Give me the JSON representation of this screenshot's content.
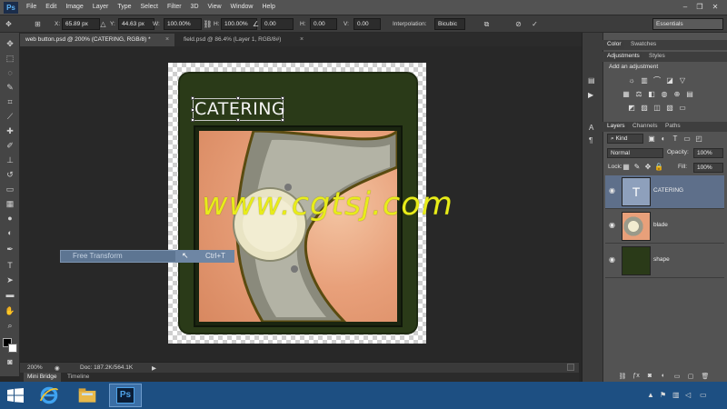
{
  "app": {
    "logo": "Ps"
  },
  "menu": [
    "File",
    "Edit",
    "Image",
    "Layer",
    "Type",
    "Select",
    "Filter",
    "3D",
    "View",
    "Window",
    "Help"
  ],
  "window_controls": {
    "minimize": "–",
    "restore": "❐",
    "close": "✕"
  },
  "options_bar": {
    "x_label": "X:",
    "x_value": "65.89 px",
    "y_label": "Y:",
    "y_value": "44.63 px",
    "w_label": "W:",
    "w_value": "100.00%",
    "h_label": "H:",
    "h_value": "100.00%",
    "angle_value": "0.00",
    "hskew_label": "H:",
    "hskew_value": "0.00",
    "vskew_label": "V:",
    "vskew_value": "0.00",
    "interp_label": "Interpolation:",
    "interp_value": "Bicubic",
    "workspace": "Essentials"
  },
  "doc_tabs": [
    {
      "label": "web button.psd @ 200% (CATERING, RGB/8) *",
      "close": "×"
    },
    {
      "label": "field.psd @ 86.4% (Layer 1, RGB/8#)",
      "close": "×"
    }
  ],
  "canvas": {
    "heading": "CATERING"
  },
  "watermark": "www.cgtsj.com",
  "tooltip": {
    "label": "Free Transform",
    "shortcut": "Ctrl+T"
  },
  "status": {
    "zoom": "200%",
    "doc": "Doc: 187.2K/564.1K",
    "arrow": "▶"
  },
  "bottom_tabs": [
    "Mini Bridge",
    "Timeline"
  ],
  "panels": {
    "color_tabs": [
      "Color",
      "Swatches"
    ],
    "adj_tabs": [
      "Adjustments",
      "Styles"
    ],
    "adj_title": "Add an adjustment",
    "layer_tabs": [
      "Layers",
      "Channels",
      "Paths"
    ],
    "kind": "Kind",
    "blend": "Normal",
    "opacity_label": "Opacity:",
    "opacity": "100%",
    "lock_label": "Lock:",
    "fill_label": "Fill:",
    "fill": "100%"
  },
  "layers": [
    {
      "name": "CATERING",
      "thumb": "T"
    },
    {
      "name": "blade"
    },
    {
      "name": "shape"
    }
  ],
  "colors": {
    "accent": "#5e6f8a",
    "card": "#2a3a18",
    "watermark": "#e8ec1a",
    "taskbar": "#1d4f82"
  }
}
